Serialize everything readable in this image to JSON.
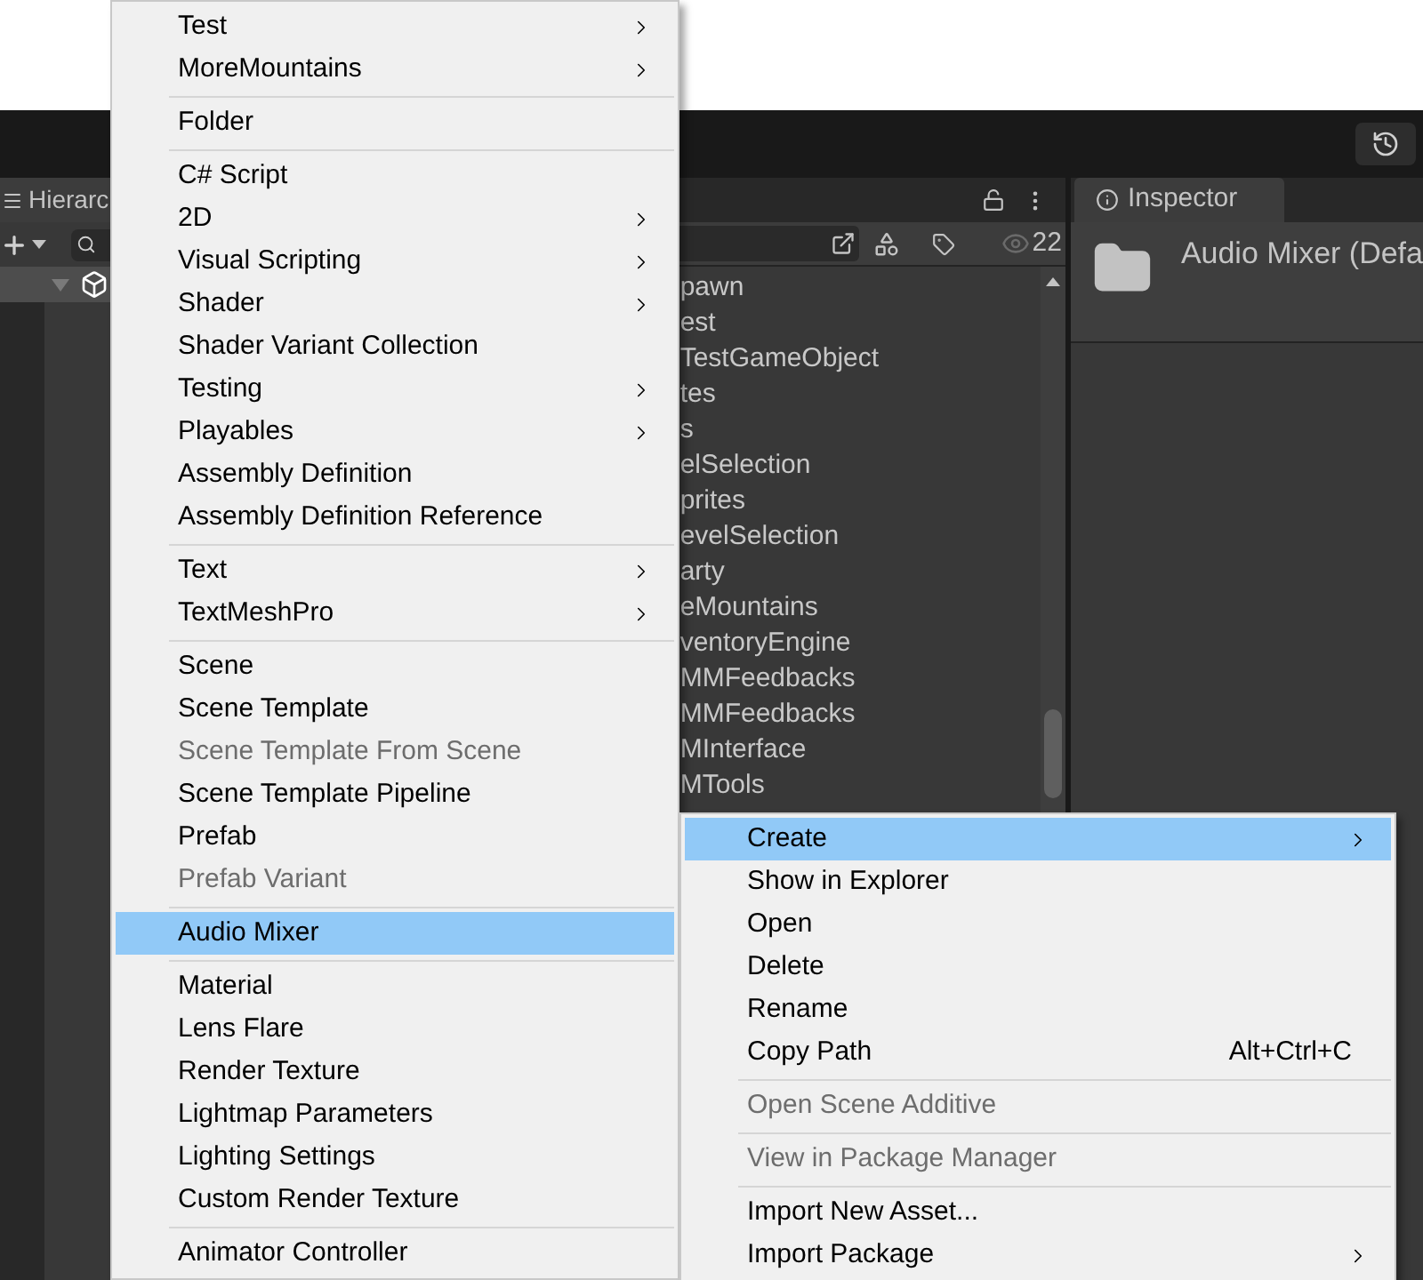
{
  "hierarchy": {
    "tab": "Hierarc"
  },
  "project": {
    "count": "22",
    "rows": [
      {
        "label": "pawn"
      },
      {
        "label": "est"
      },
      {
        "label": "TestGameObject"
      },
      {
        "label": "tes"
      },
      {
        "label": "s"
      },
      {
        "label": "elSelection"
      },
      {
        "label": "prites"
      },
      {
        "label": "evelSelection"
      },
      {
        "label": "arty"
      },
      {
        "label": "eMountains"
      },
      {
        "label": "ventoryEngine"
      },
      {
        "label": "MMFeedbacks"
      },
      {
        "label": "MMFeedbacks"
      },
      {
        "label": "MInterface"
      },
      {
        "label": "MTools"
      }
    ]
  },
  "inspector": {
    "tab": "Inspector",
    "title": "Audio Mixer (Defa"
  },
  "menus": [
    {
      "items": [
        {
          "kind": "item",
          "label": "Test",
          "submenu": true,
          "disabled": false,
          "selected": false
        },
        {
          "kind": "item",
          "label": "MoreMountains",
          "submenu": true,
          "disabled": false,
          "selected": false
        },
        {
          "kind": "separator"
        },
        {
          "kind": "item",
          "label": "Folder",
          "submenu": false,
          "disabled": false,
          "selected": false
        },
        {
          "kind": "separator"
        },
        {
          "kind": "item",
          "label": "C# Script",
          "submenu": false,
          "disabled": false,
          "selected": false
        },
        {
          "kind": "item",
          "label": "2D",
          "submenu": true,
          "disabled": false,
          "selected": false
        },
        {
          "kind": "item",
          "label": "Visual Scripting",
          "submenu": true,
          "disabled": false,
          "selected": false
        },
        {
          "kind": "item",
          "label": "Shader",
          "submenu": true,
          "disabled": false,
          "selected": false
        },
        {
          "kind": "item",
          "label": "Shader Variant Collection",
          "submenu": false,
          "disabled": false,
          "selected": false
        },
        {
          "kind": "item",
          "label": "Testing",
          "submenu": true,
          "disabled": false,
          "selected": false
        },
        {
          "kind": "item",
          "label": "Playables",
          "submenu": true,
          "disabled": false,
          "selected": false
        },
        {
          "kind": "item",
          "label": "Assembly Definition",
          "submenu": false,
          "disabled": false,
          "selected": false
        },
        {
          "kind": "item",
          "label": "Assembly Definition Reference",
          "submenu": false,
          "disabled": false,
          "selected": false
        },
        {
          "kind": "separator"
        },
        {
          "kind": "item",
          "label": "Text",
          "submenu": true,
          "disabled": false,
          "selected": false
        },
        {
          "kind": "item",
          "label": "TextMeshPro",
          "submenu": true,
          "disabled": false,
          "selected": false
        },
        {
          "kind": "separator"
        },
        {
          "kind": "item",
          "label": "Scene",
          "submenu": false,
          "disabled": false,
          "selected": false
        },
        {
          "kind": "item",
          "label": "Scene Template",
          "submenu": false,
          "disabled": false,
          "selected": false
        },
        {
          "kind": "item",
          "label": "Scene Template From Scene",
          "submenu": false,
          "disabled": true,
          "selected": false
        },
        {
          "kind": "item",
          "label": "Scene Template Pipeline",
          "submenu": false,
          "disabled": false,
          "selected": false
        },
        {
          "kind": "item",
          "label": "Prefab",
          "submenu": false,
          "disabled": false,
          "selected": false
        },
        {
          "kind": "item",
          "label": "Prefab Variant",
          "submenu": false,
          "disabled": true,
          "selected": false
        },
        {
          "kind": "separator"
        },
        {
          "kind": "item",
          "label": "Audio Mixer",
          "submenu": false,
          "disabled": false,
          "selected": true
        },
        {
          "kind": "separator"
        },
        {
          "kind": "item",
          "label": "Material",
          "submenu": false,
          "disabled": false,
          "selected": false
        },
        {
          "kind": "item",
          "label": "Lens Flare",
          "submenu": false,
          "disabled": false,
          "selected": false
        },
        {
          "kind": "item",
          "label": "Render Texture",
          "submenu": false,
          "disabled": false,
          "selected": false
        },
        {
          "kind": "item",
          "label": "Lightmap Parameters",
          "submenu": false,
          "disabled": false,
          "selected": false
        },
        {
          "kind": "item",
          "label": "Lighting Settings",
          "submenu": false,
          "disabled": false,
          "selected": false
        },
        {
          "kind": "item",
          "label": "Custom Render Texture",
          "submenu": false,
          "disabled": false,
          "selected": false
        },
        {
          "kind": "separator"
        },
        {
          "kind": "item",
          "label": "Animator Controller",
          "submenu": false,
          "disabled": false,
          "selected": false
        }
      ]
    },
    {
      "items": [
        {
          "kind": "item",
          "label": "Create",
          "submenu": true,
          "disabled": false,
          "selected": true
        },
        {
          "kind": "item",
          "label": "Show in Explorer",
          "submenu": false,
          "disabled": false,
          "selected": false
        },
        {
          "kind": "item",
          "label": "Open",
          "submenu": false,
          "disabled": false,
          "selected": false
        },
        {
          "kind": "item",
          "label": "Delete",
          "submenu": false,
          "disabled": false,
          "selected": false
        },
        {
          "kind": "item",
          "label": "Rename",
          "submenu": false,
          "disabled": false,
          "selected": false
        },
        {
          "kind": "item",
          "label": "Copy Path",
          "shortcut": "Alt+Ctrl+C",
          "submenu": false,
          "disabled": false,
          "selected": false
        },
        {
          "kind": "separator"
        },
        {
          "kind": "item",
          "label": "Open Scene Additive",
          "submenu": false,
          "disabled": true,
          "selected": false
        },
        {
          "kind": "separator"
        },
        {
          "kind": "item",
          "label": "View in Package Manager",
          "submenu": false,
          "disabled": true,
          "selected": false
        },
        {
          "kind": "separator"
        },
        {
          "kind": "item",
          "label": "Import New Asset...",
          "submenu": false,
          "disabled": false,
          "selected": false
        },
        {
          "kind": "item",
          "label": "Import Package",
          "submenu": true,
          "disabled": false,
          "selected": false
        }
      ]
    }
  ]
}
